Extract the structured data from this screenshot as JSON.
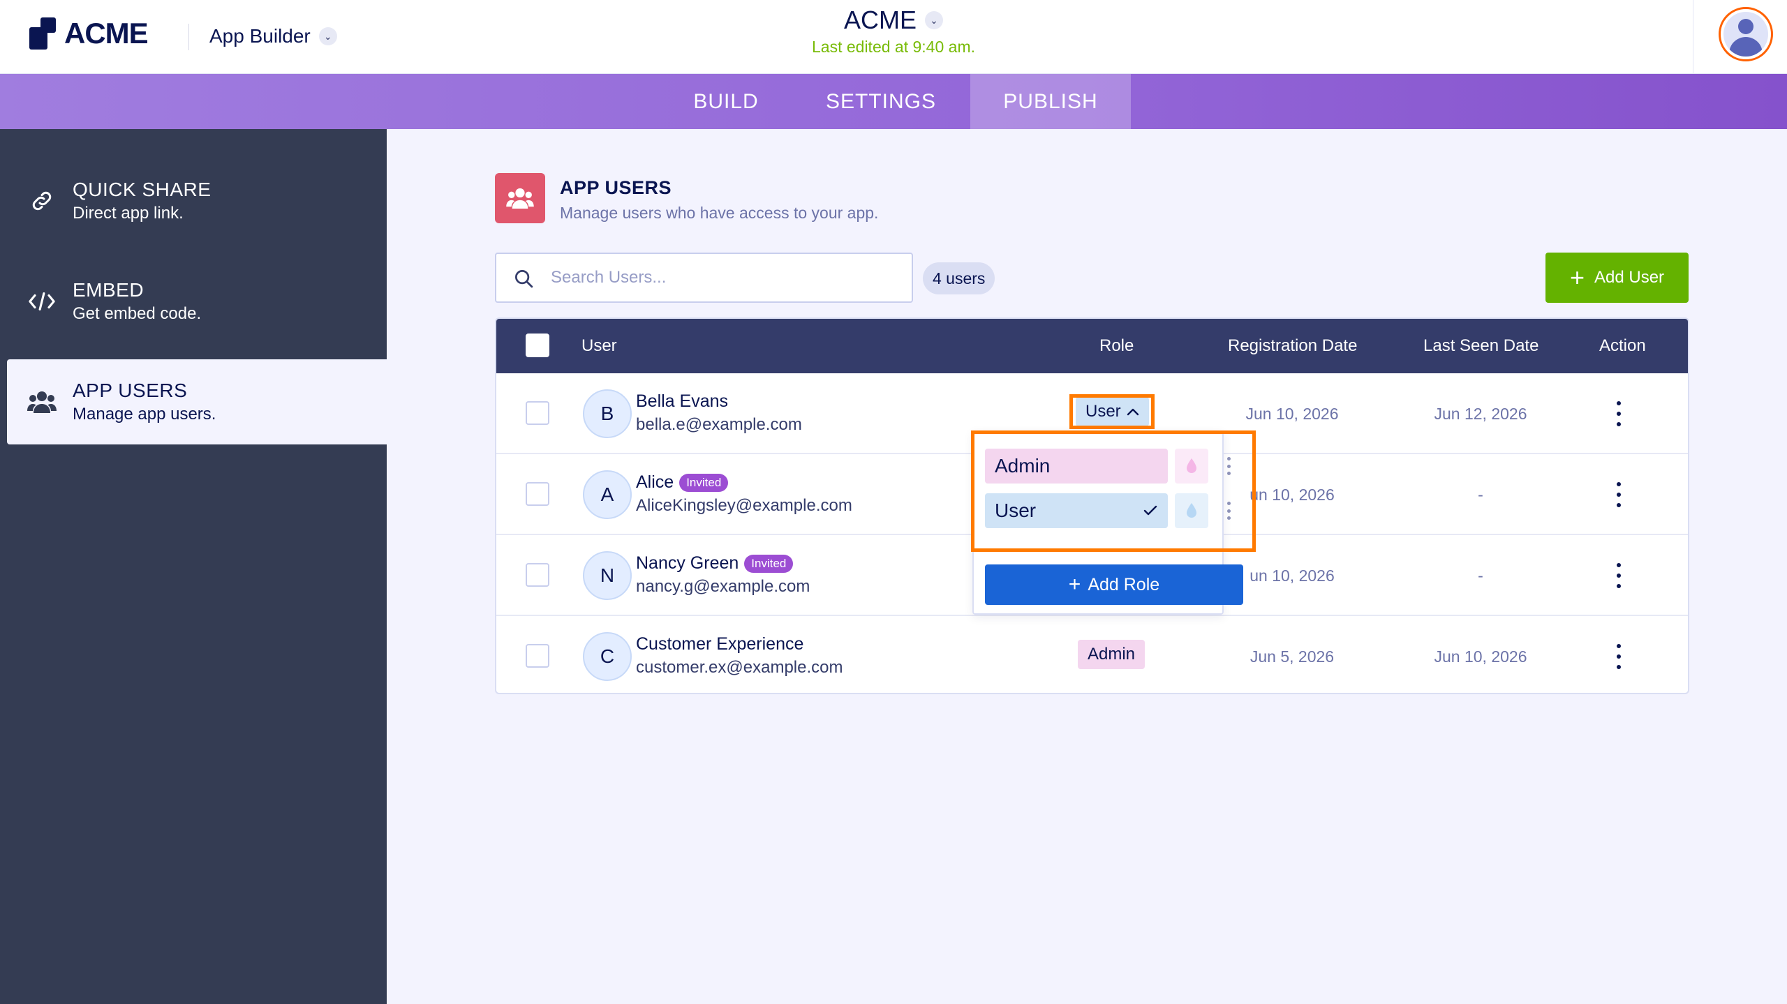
{
  "header": {
    "logo_text": "ACME",
    "app_builder_label": "App Builder",
    "title": "ACME",
    "last_edited": "Last edited at 9:40 am."
  },
  "nav": {
    "tabs": [
      {
        "label": "BUILD",
        "active": false
      },
      {
        "label": "SETTINGS",
        "active": false
      },
      {
        "label": "PUBLISH",
        "active": true
      }
    ]
  },
  "sidebar": {
    "items": [
      {
        "title": "QUICK SHARE",
        "subtitle": "Direct app link.",
        "icon": "link-icon"
      },
      {
        "title": "EMBED",
        "subtitle": "Get embed code.",
        "icon": "code-icon"
      },
      {
        "title": "APP USERS",
        "subtitle": "Manage app users.",
        "icon": "users-icon",
        "active": true
      }
    ]
  },
  "main": {
    "title": "APP USERS",
    "subtitle": "Manage users who have access to your app.",
    "search_placeholder": "Search Users...",
    "user_count": "4 users",
    "add_user_label": "Add User"
  },
  "table": {
    "columns": [
      "User",
      "Role",
      "Registration Date",
      "Last Seen Date",
      "Action"
    ],
    "rows": [
      {
        "initial": "B",
        "name": "Bella Evans",
        "email": "bella.e@example.com",
        "invited": "",
        "role": "User",
        "registration": "Jun 10, 2026",
        "last_seen": "Jun 12, 2026"
      },
      {
        "initial": "A",
        "name": "Alice",
        "email": "AliceKingsley@example.com",
        "invited": "Invited",
        "role": "",
        "registration": "un 10, 2026",
        "last_seen": "-"
      },
      {
        "initial": "N",
        "name": "Nancy Green",
        "email": "nancy.g@example.com",
        "invited": "Invited",
        "role": "",
        "registration": "un 10, 2026",
        "last_seen": "-"
      },
      {
        "initial": "C",
        "name": "Customer Experience",
        "email": "customer.ex@example.com",
        "invited": "",
        "role": "Admin",
        "registration": "Jun 5, 2026",
        "last_seen": "Jun 10, 2026"
      }
    ]
  },
  "role_dropdown": {
    "options": [
      {
        "label": "Admin",
        "selected": false,
        "color": "#f4d6ef"
      },
      {
        "label": "User",
        "selected": true,
        "color": "#cfe3f6"
      }
    ],
    "add_role_label": "Add Role"
  },
  "colors": {
    "accent_purple": "#9366d8",
    "sidebar_bg": "#343c53",
    "table_header": "#343c6a",
    "add_user_green": "#64b200",
    "add_role_blue": "#1a64d6",
    "highlight_orange": "#ff7a00",
    "last_edited_green": "#78bb07"
  }
}
